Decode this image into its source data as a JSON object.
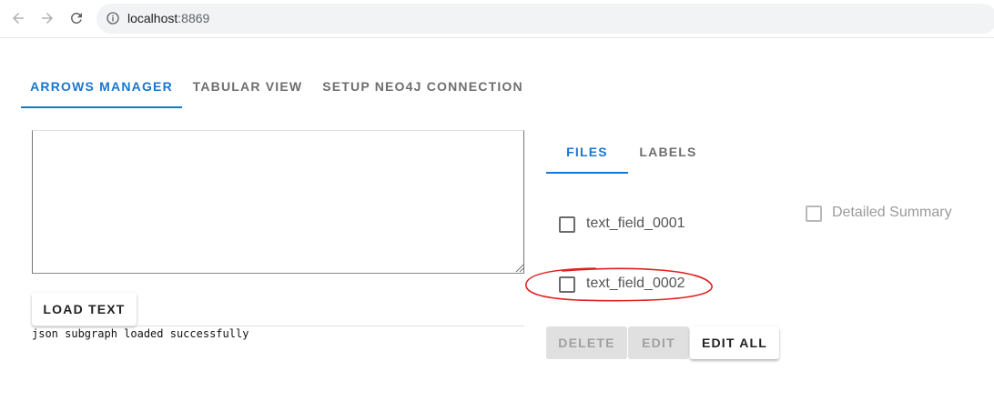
{
  "browser": {
    "url_host": "localhost",
    "url_port": ":8869"
  },
  "main_tabs": [
    {
      "label": "ARROWS MANAGER",
      "active": true
    },
    {
      "label": "TABULAR VIEW",
      "active": false
    },
    {
      "label": "SETUP NEO4J CONNECTION",
      "active": false
    }
  ],
  "editor": {
    "text_value": "",
    "load_button_label": "LOAD TEXT",
    "status_message": "json subgraph loaded successfully"
  },
  "side_tabs": [
    {
      "label": "FILES",
      "active": true
    },
    {
      "label": "LABELS",
      "active": false
    }
  ],
  "files": [
    {
      "label": "text_field_0001",
      "checked": false
    },
    {
      "label": "text_field_0002",
      "checked": false
    }
  ],
  "detailed_summary": {
    "label": "Detailed Summary",
    "checked": false,
    "disabled": true
  },
  "actions": {
    "delete_label": "DELETE",
    "edit_label": "EDIT",
    "edit_all_label": "EDIT ALL"
  },
  "colors": {
    "accent": "#1976d2",
    "annotation": "#e02020",
    "disabled_bg": "#e0e0e0"
  }
}
